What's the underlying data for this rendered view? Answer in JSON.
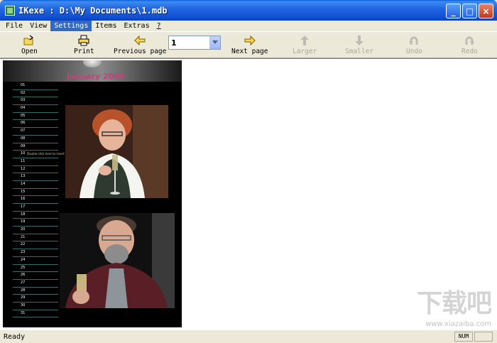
{
  "window": {
    "title": "IKexe : D:\\My Documents\\1.mdb",
    "minimize_glyph": "_",
    "maximize_glyph": "□",
    "close_glyph": "×"
  },
  "menu": {
    "items": [
      {
        "label": "File"
      },
      {
        "label": "View"
      },
      {
        "label": "Settings"
      },
      {
        "label": "Items"
      },
      {
        "label": "Extras"
      },
      {
        "label": "?"
      }
    ],
    "active": "Settings"
  },
  "toolbar": {
    "open_label": "Open",
    "print_label": "Print",
    "previous_label": "Previous page",
    "page_value": "1",
    "next_label": "Next page",
    "larger_label": "Larger",
    "smaller_label": "Smaller",
    "undo_label": "Undo",
    "redo_label": "Redo"
  },
  "calendar": {
    "title": "January 2009",
    "days": [
      "01",
      "02",
      "03",
      "04",
      "05",
      "06",
      "07",
      "08",
      "09",
      "10",
      "11",
      "12",
      "13",
      "14",
      "15",
      "16",
      "17",
      "18",
      "19",
      "20",
      "21",
      "22",
      "23",
      "24",
      "25",
      "26",
      "27",
      "28",
      "29",
      "30",
      "31"
    ],
    "day10_note": "Double-click here to insert text"
  },
  "watermark": {
    "text": "下载吧",
    "sub": "www.xiazaiba.com"
  },
  "status": {
    "text": "Ready",
    "num": "NUM"
  },
  "colors": {
    "titlebar": "#0f4fd2",
    "menu_active": "#316ac5",
    "calendar_title": "#c8407a",
    "chrome": "#ece9d8"
  }
}
